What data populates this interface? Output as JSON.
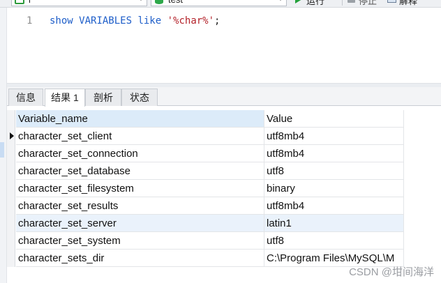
{
  "toolbar": {
    "connection_value": "l",
    "database_value": "test",
    "run_label": "运行",
    "stop_label": "停止",
    "explain_label": "解释"
  },
  "editor": {
    "line_number": "1",
    "tokens": {
      "show": "show",
      "variables": "VARIABLES",
      "like": "like",
      "pattern": "'%char%'",
      "semicolon": ";"
    }
  },
  "tabs": [
    {
      "label": "信息"
    },
    {
      "label": "结果 1"
    },
    {
      "label": "剖析"
    },
    {
      "label": "状态"
    }
  ],
  "results": {
    "columns": [
      "Variable_name",
      "Value"
    ],
    "rows": [
      [
        "character_set_client",
        "utf8mb4"
      ],
      [
        "character_set_connection",
        "utf8mb4"
      ],
      [
        "character_set_database",
        "utf8"
      ],
      [
        "character_set_filesystem",
        "binary"
      ],
      [
        "character_set_results",
        "utf8mb4"
      ],
      [
        "character_set_server",
        "latin1"
      ],
      [
        "character_set_system",
        "utf8"
      ],
      [
        "character_sets_dir",
        "C:\\Program Files\\MySQL\\M"
      ]
    ]
  },
  "watermark": "CSDN @坩间海洋"
}
